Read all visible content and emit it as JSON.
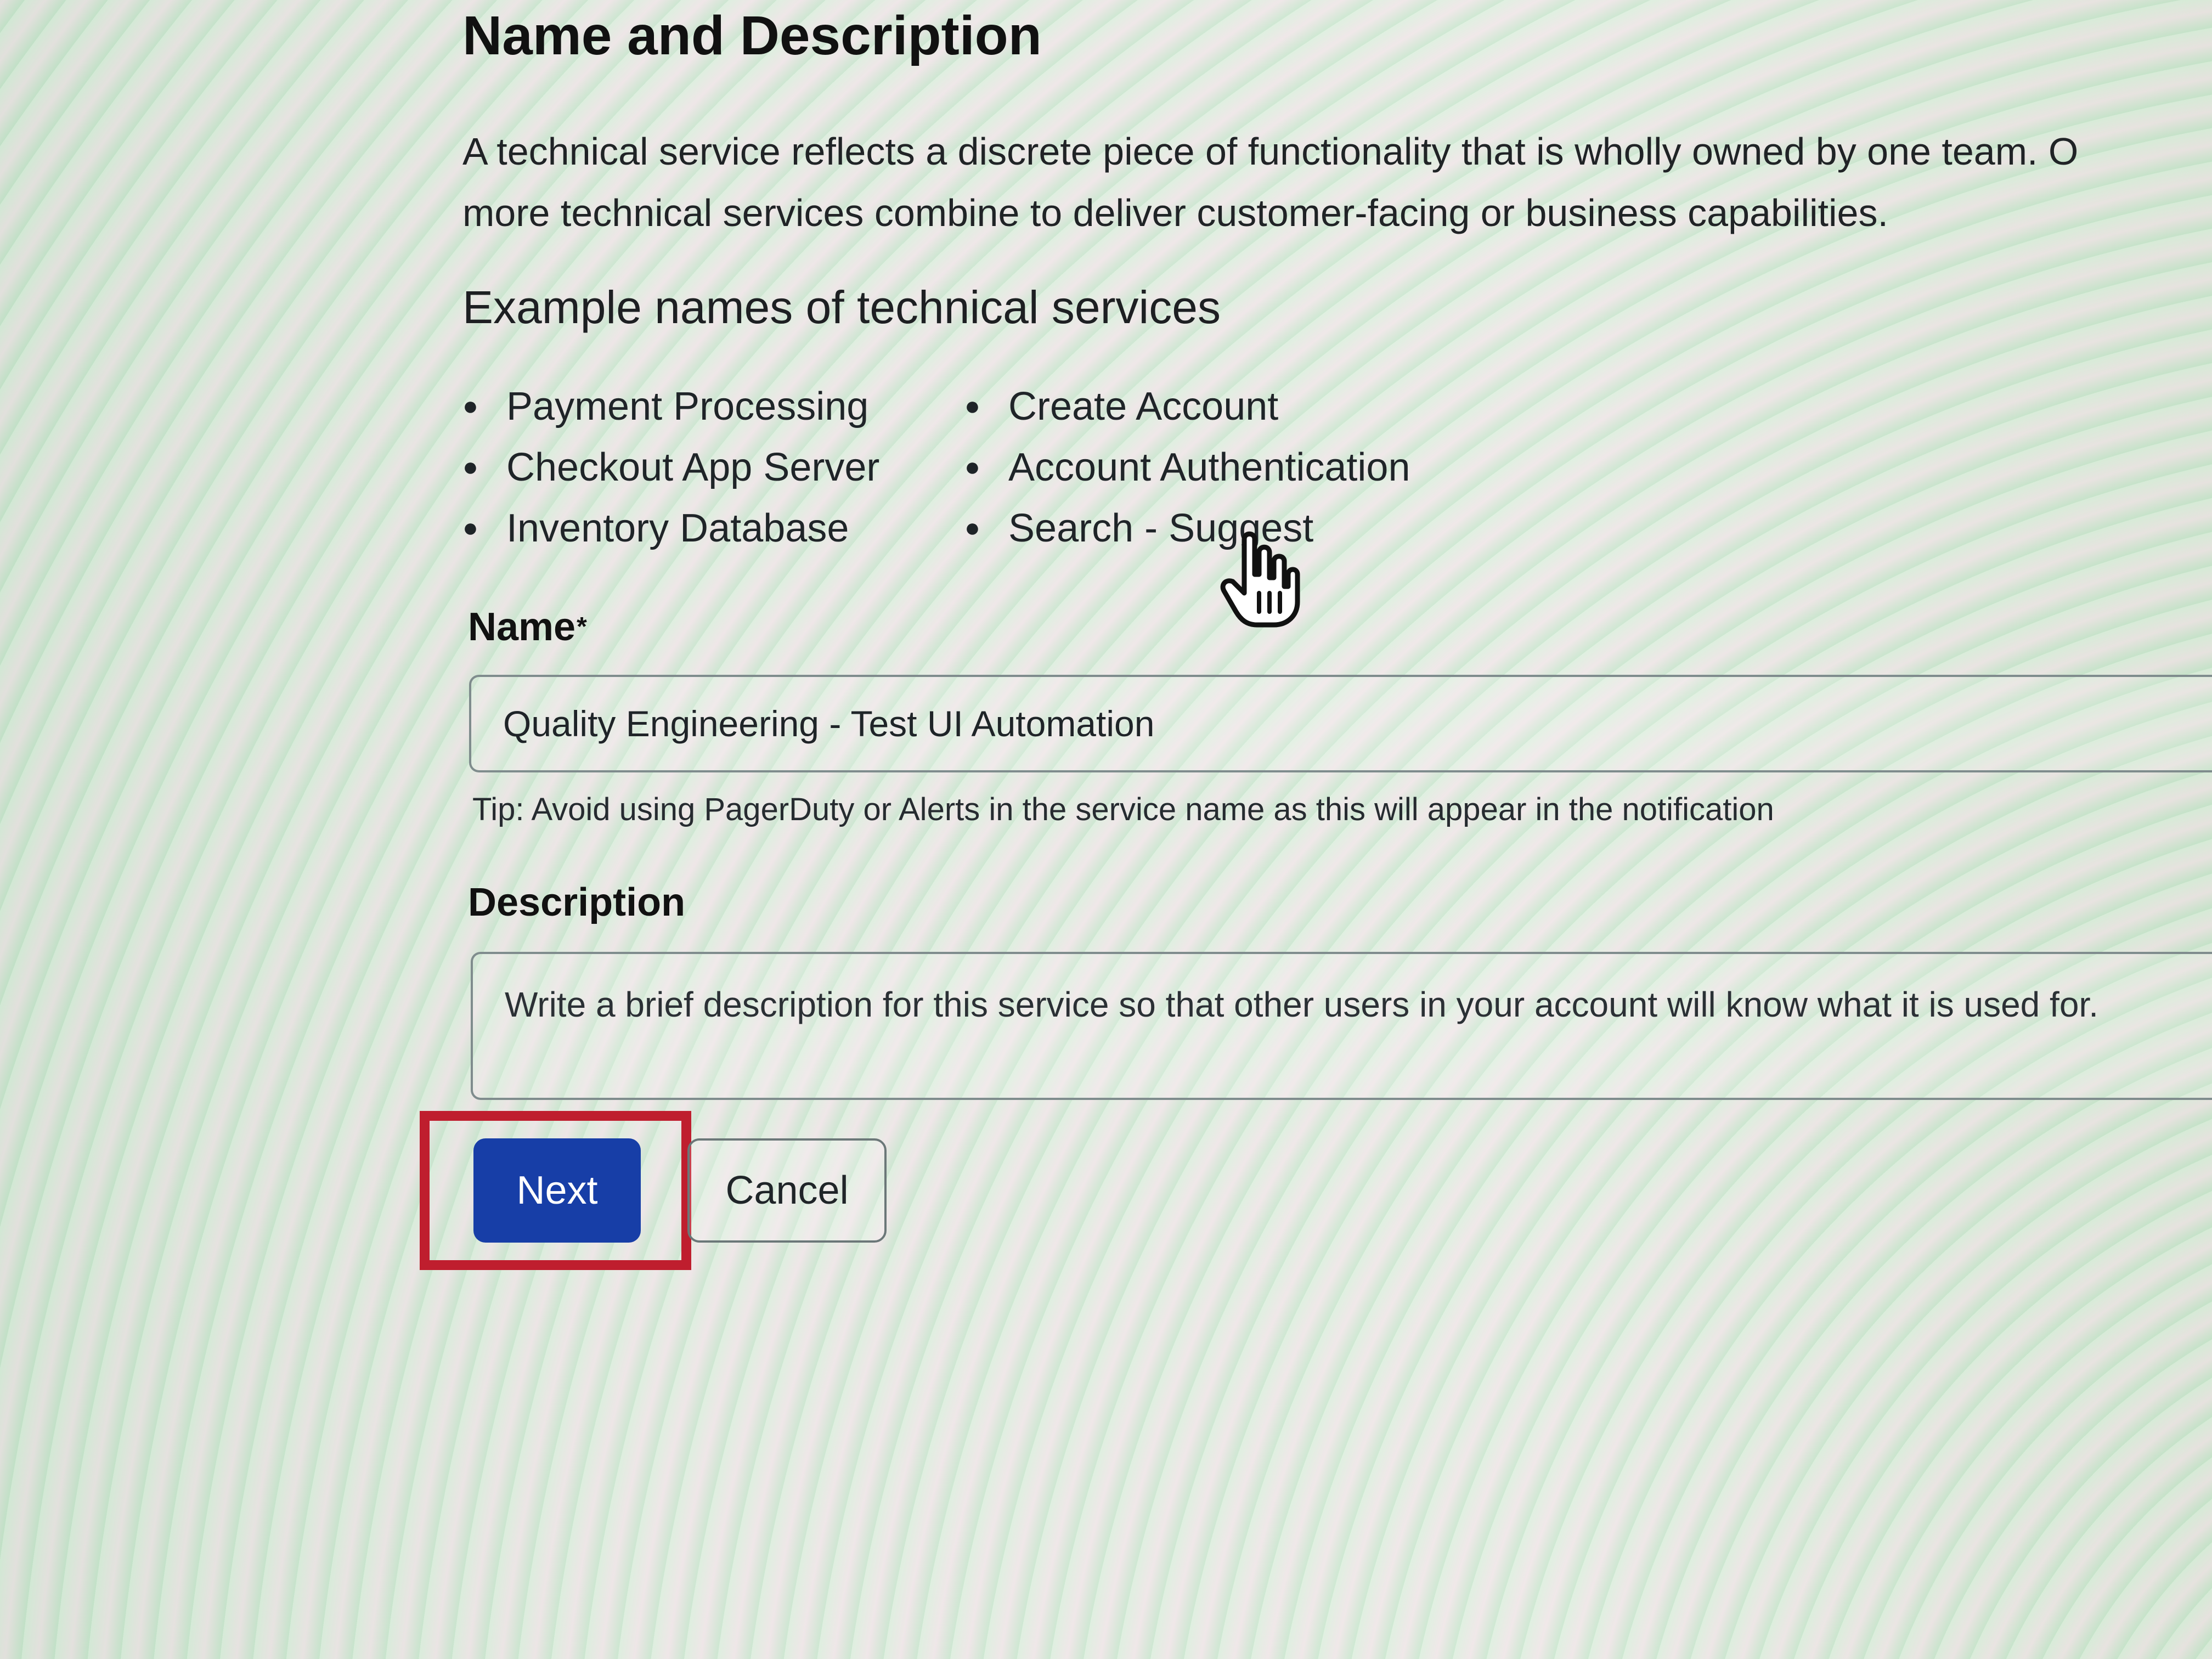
{
  "form": {
    "title": "Name and Description",
    "intro": [
      "A technical service reflects a discrete piece of functionality that is wholly owned by one team. O",
      "more technical services combine to deliver customer-facing or business capabilities."
    ],
    "examples_heading": "Example names of technical services",
    "examples": [
      "Payment Processing",
      "Create Account",
      "Checkout App Server",
      "Account Authentication",
      "Inventory Database",
      "Search - Suggest"
    ],
    "name_label": "Name",
    "required_mark": "*",
    "name_value": "Quality Engineering - Test UI Automation",
    "tip": "Tip: Avoid using PagerDuty or Alerts in the service name as this will appear in the notification",
    "description_label": "Description",
    "description_placeholder": "Write a brief description for this service so that other users in your account will know what it is used for.",
    "next_label": "Next",
    "cancel_label": "Cancel"
  },
  "icons": {
    "cursor": "pointer-hand-icon"
  },
  "colors": {
    "primary_button": "#173ea7",
    "highlight_border": "#bf1e2e",
    "input_border": "#7f8c8d",
    "text": "#1f2428"
  }
}
